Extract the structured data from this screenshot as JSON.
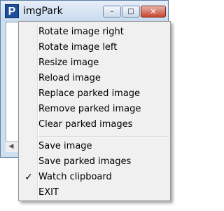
{
  "window": {
    "app_icon_letter": "P",
    "title": "imgPark",
    "controls": {
      "minimize": "–",
      "maximize": "□",
      "close": "✕"
    }
  },
  "menu": {
    "group1": [
      {
        "label": "Rotate image right"
      },
      {
        "label": "Rotate image left"
      },
      {
        "label": "Resize image"
      },
      {
        "label": "Reload image"
      },
      {
        "label": "Replace parked image"
      },
      {
        "label": "Remove parked image"
      },
      {
        "label": "Clear parked images"
      }
    ],
    "group2": [
      {
        "label": "Save image",
        "checked": false
      },
      {
        "label": "Save parked images",
        "checked": false
      },
      {
        "label": "Watch clipboard",
        "checked": true,
        "check_glyph": "✓"
      },
      {
        "label": "EXIT",
        "checked": false
      }
    ]
  }
}
